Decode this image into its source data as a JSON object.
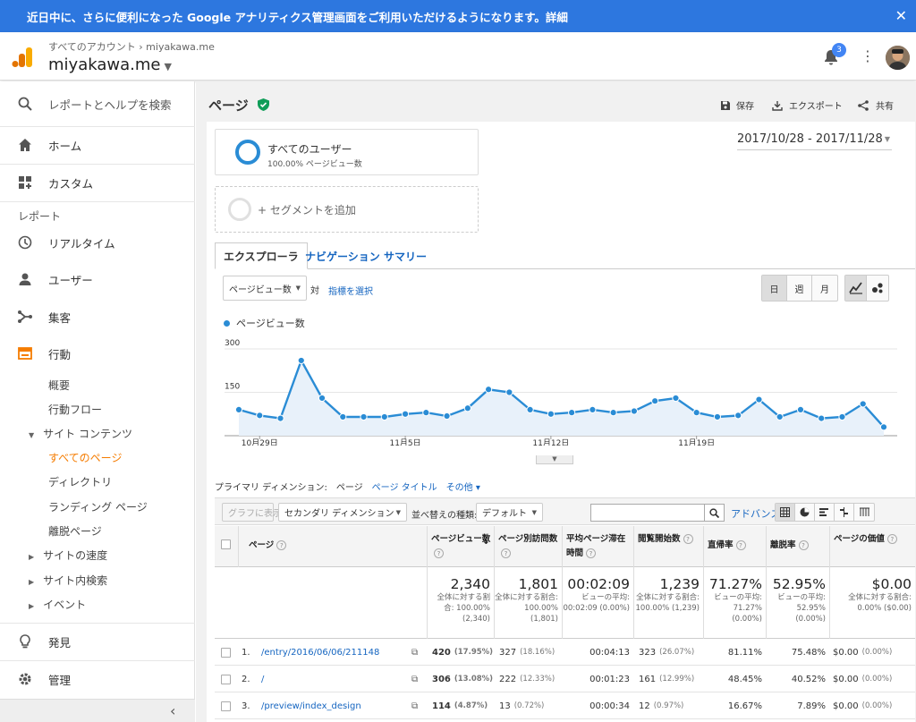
{
  "banner": {
    "text": "近日中に、さらに便利になった Google アナリティクス管理画面をご利用いただけるようになります。詳細",
    "close": "✕"
  },
  "header": {
    "breadcrumb": "すべてのアカウント › miyakawa.me",
    "property": "miyakawa.me",
    "notif_count": "3"
  },
  "sidebar": {
    "search": "レポートとヘルプを検索",
    "home": "ホーム",
    "custom": "カスタム",
    "reports_label": "レポート",
    "realtime": "リアルタイム",
    "users": "ユーザー",
    "acquisition": "集客",
    "behavior": "行動",
    "sub": [
      "概要",
      "行動フロー",
      "サイト コンテンツ",
      "すべてのページ",
      "ディレクトリ",
      "ランディング ページ",
      "離脱ページ",
      "サイトの速度",
      "サイト内検索",
      "イベント"
    ],
    "discover": "発見",
    "admin": "管理",
    "collapse": "‹"
  },
  "page": {
    "title": "ページ",
    "save": "保存",
    "export": "エクスポート",
    "share": "共有"
  },
  "segment": {
    "name": "すべてのユーザー",
    "sub": "100.00% ページビュー数",
    "add": "+ セグメントを追加"
  },
  "daterange": "2017/10/28 - 2017/11/28",
  "tabs": [
    "エクスプローラ",
    "ナビゲーション サマリー"
  ],
  "metric": {
    "selected": "ページビュー数",
    "vs": "対",
    "choose": "指標を選択"
  },
  "period": [
    "日",
    "週",
    "月"
  ],
  "chart_data": {
    "type": "area",
    "series": [
      {
        "name": "ページビュー数",
        "values": [
          90,
          70,
          60,
          260,
          130,
          65,
          65,
          65,
          75,
          80,
          68,
          95,
          160,
          150,
          90,
          75,
          80,
          90,
          80,
          85,
          120,
          130,
          80,
          65,
          70,
          125,
          65,
          90,
          60,
          65,
          110,
          30
        ]
      }
    ],
    "x_tick_labels": [
      "10月29日",
      "11月5日",
      "11月12日",
      "11月19日"
    ],
    "x_tick_index": [
      1,
      8,
      15,
      22
    ],
    "y_ticks": [
      150,
      300
    ],
    "ylim": [
      0,
      300
    ],
    "color": "#2a8cd5"
  },
  "dimension": {
    "label": "プライマリ ディメンション:",
    "current": "ページ",
    "alt": "ページ タイトル",
    "other": "その他 ▾"
  },
  "controls": {
    "graph": "グラフに表示",
    "secondary": "セカンダリ ディメンション",
    "sort_label": "並べ替えの種類:",
    "sort": "デフォルト",
    "advanced": "アドバンス"
  },
  "table": {
    "headers": [
      "ページ",
      "ページビュー数",
      "ページ別訪問数",
      "平均ページ滞在時間",
      "閲覧開始数",
      "直帰率",
      "離脱率",
      "ページの価値"
    ],
    "totals": [
      {
        "big": "2,340",
        "small": "全体に対する割合: 100.00% (2,340)"
      },
      {
        "big": "1,801",
        "small": "全体に対する割合: 100.00% (1,801)"
      },
      {
        "big": "00:02:09",
        "small": "ビューの平均: 00:02:09 (0.00%)"
      },
      {
        "big": "1,239",
        "small": "全体に対する割合: 100.00% (1,239)"
      },
      {
        "big": "71.27%",
        "small": "ビューの平均: 71.27% (0.00%)"
      },
      {
        "big": "52.95%",
        "small": "ビューの平均: 52.95% (0.00%)"
      },
      {
        "big": "$0.00",
        "small": "全体に対する割合: 0.00% ($0.00)"
      }
    ],
    "rows": [
      {
        "n": "1.",
        "page": "/entry/2016/06/06/211148",
        "pv": "420",
        "pvp": "(17.95%)",
        "up": "327",
        "upp": "(18.16%)",
        "time": "00:04:13",
        "ent": "323",
        "entp": "(26.07%)",
        "bounce": "81.11%",
        "exit": "75.48%",
        "val": "$0.00",
        "valp": "(0.00%)"
      },
      {
        "n": "2.",
        "page": "/",
        "pv": "306",
        "pvp": "(13.08%)",
        "up": "222",
        "upp": "(12.33%)",
        "time": "00:01:23",
        "ent": "161",
        "entp": "(12.99%)",
        "bounce": "48.45%",
        "exit": "40.52%",
        "val": "$0.00",
        "valp": "(0.00%)"
      },
      {
        "n": "3.",
        "page": "/preview/index_design",
        "pv": "114",
        "pvp": "(4.87%)",
        "up": "13",
        "upp": "(0.72%)",
        "time": "00:00:34",
        "ent": "12",
        "entp": "(0.97%)",
        "bounce": "16.67%",
        "exit": "7.89%",
        "val": "$0.00",
        "valp": "(0.00%)"
      }
    ]
  }
}
